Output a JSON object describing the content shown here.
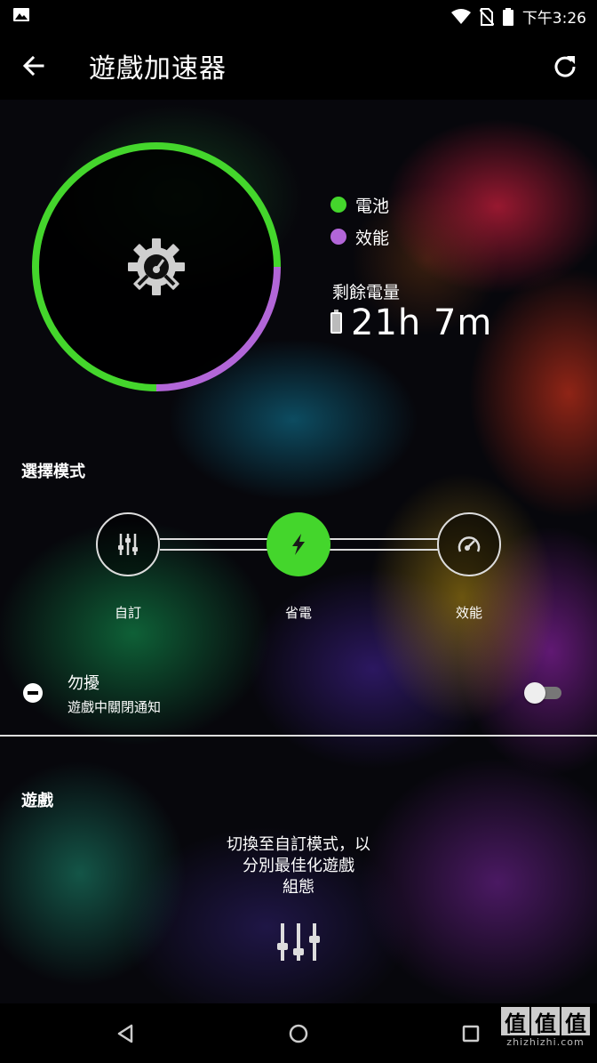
{
  "status_bar": {
    "time": "下午3:26",
    "icons": [
      "image-notification-icon",
      "wifi-icon",
      "no-sim-icon",
      "battery-icon"
    ]
  },
  "app_bar": {
    "title": "遊戲加速器",
    "back_icon": "arrow-left-icon",
    "refresh_icon": "refresh-icon"
  },
  "usage_ring": {
    "battery_fraction": 0.75,
    "performance_fraction": 0.25,
    "center_icon": "gear-gauge-icon"
  },
  "legend": {
    "items": [
      {
        "label": "電池",
        "color": "#44d62c"
      },
      {
        "label": "效能",
        "color": "#b266d8"
      }
    ]
  },
  "remaining": {
    "label": "剩餘電量",
    "value": "21h 7m"
  },
  "mode_select": {
    "label": "選擇模式",
    "modes": [
      {
        "label": "自訂",
        "icon": "sliders-icon",
        "selected": false
      },
      {
        "label": "省電",
        "icon": "lightning-icon",
        "selected": true
      },
      {
        "label": "效能",
        "icon": "speedometer-icon",
        "selected": false
      }
    ]
  },
  "dnd": {
    "title": "勿擾",
    "subtitle": "遊戲中關閉通知",
    "enabled": false
  },
  "games": {
    "label": "遊戲",
    "hint_lines": [
      "切換至自訂模式，以",
      "分別最佳化遊戲",
      "組態"
    ],
    "icon": "sliders-icon"
  },
  "nav_bar": {
    "buttons": [
      "back-triangle-icon",
      "home-circle-icon",
      "recents-square-icon"
    ]
  },
  "watermark": {
    "logo_chars": [
      "值",
      "值",
      "值"
    ],
    "text": "zhizhizhi.com"
  },
  "colors": {
    "accent_green": "#44d62c",
    "performance_purple": "#b266d8"
  }
}
